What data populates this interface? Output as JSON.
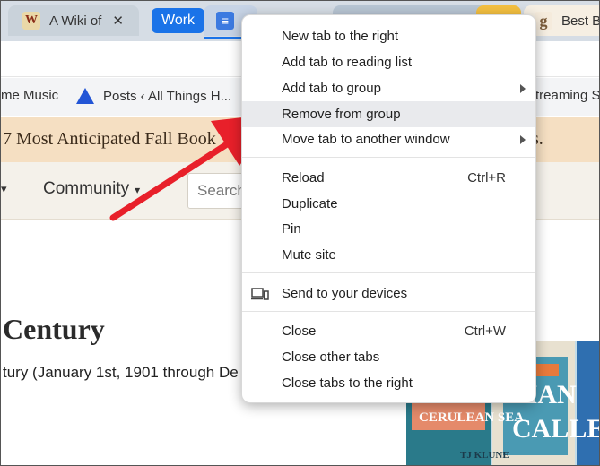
{
  "tabs": {
    "tab1": {
      "title": "A Wiki of",
      "favicon": "W",
      "close": "✕"
    },
    "group_label": "Work",
    "tab5": {
      "title": "Best B",
      "favicon": "g"
    }
  },
  "bookmarks": {
    "item1": "me Music",
    "item2": "Posts ‹ All Things H...",
    "item3": "treaming S"
  },
  "banner": {
    "text": "7 Most Anticipated Fall Book",
    "tail": "s."
  },
  "site_nav": {
    "community": "Community",
    "caret": "▾",
    "chev": "▾",
    "search_placeholder": "Search"
  },
  "page": {
    "heading": "Century",
    "paragraph": "tury (January 1st, 1901 through De"
  },
  "books": {
    "title_line1": "MAN",
    "title_line2": "CALLED",
    "small_title": "CERULEAN SEA",
    "author": "TJ KLUNE"
  },
  "context_menu": {
    "items": [
      {
        "label": "New tab to the right"
      },
      {
        "label": "Add tab to reading list"
      },
      {
        "label": "Add tab to group",
        "submenu": true
      },
      {
        "label": "Remove from group",
        "highlighted": true
      },
      {
        "label": "Move tab to another window",
        "submenu": true
      },
      {
        "label": "Reload",
        "shortcut": "Ctrl+R"
      },
      {
        "label": "Duplicate"
      },
      {
        "label": "Pin"
      },
      {
        "label": "Mute site"
      },
      {
        "label": "Send to your devices",
        "icon": "devices-icon"
      },
      {
        "label": "Close",
        "shortcut": "Ctrl+W"
      },
      {
        "label": "Close other tabs"
      },
      {
        "label": "Close tabs to the right"
      }
    ]
  },
  "colors": {
    "accent": "#1a73e8",
    "arrow": "#e8202a",
    "highlight": "#e9eaed"
  }
}
